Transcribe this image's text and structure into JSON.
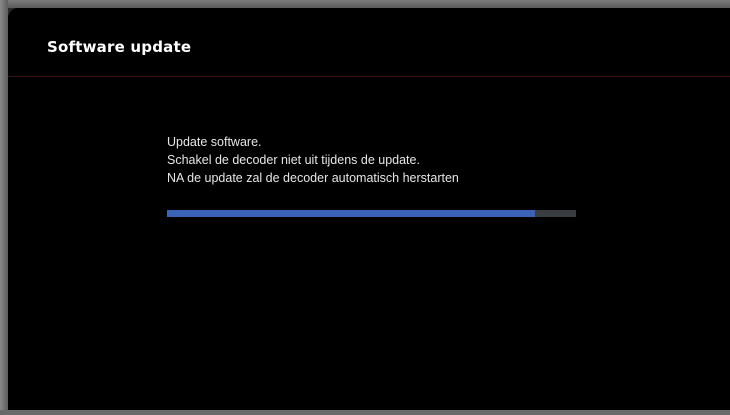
{
  "header": {
    "title": "Software update"
  },
  "message": {
    "lines": [
      "Update software.",
      "Schakel de decoder niet uit tijdens de update.",
      "NA de update zal de decoder automatisch herstarten"
    ]
  },
  "progress": {
    "percent": 90,
    "fill_color": "#3a63b8",
    "track_color": "#3a3d40"
  }
}
